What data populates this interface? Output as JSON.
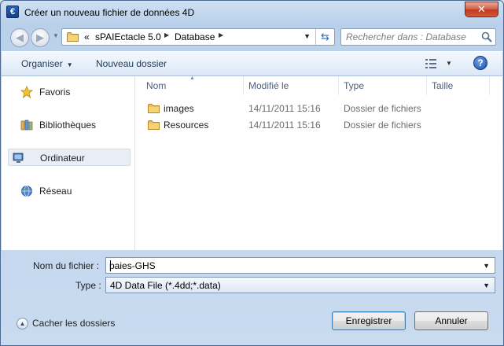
{
  "window": {
    "title": "Créer un nouveau fichier de données 4D",
    "app_icon_glyph": "€",
    "close_glyph": "✕"
  },
  "address": {
    "overflow": "«",
    "segments": [
      "sPAIEctacle 5.0",
      "Database"
    ],
    "search_placeholder": "Rechercher dans : Database"
  },
  "toolbar": {
    "organize_label": "Organiser",
    "new_folder_label": "Nouveau dossier",
    "help_glyph": "?"
  },
  "nav": {
    "items": [
      {
        "label": "Favoris",
        "icon": "star-icon"
      },
      {
        "label": "Bibliothèques",
        "icon": "library-icon"
      },
      {
        "label": "Ordinateur",
        "icon": "computer-icon",
        "selected": true
      },
      {
        "label": "Réseau",
        "icon": "network-icon"
      }
    ]
  },
  "files": {
    "columns": [
      "Nom",
      "Modifié le",
      "Type",
      "Taille"
    ],
    "rows": [
      {
        "name": "images",
        "modified": "14/11/2011 15:16",
        "type": "Dossier de fichiers",
        "size": ""
      },
      {
        "name": "Resources",
        "modified": "14/11/2011 15:16",
        "type": "Dossier de fichiers",
        "size": ""
      }
    ]
  },
  "form": {
    "filename_label": "Nom du fichier :",
    "filename_value": "paies-GHS",
    "type_label": "Type :",
    "type_value": "4D Data File (*.4dd;*.data)"
  },
  "footer": {
    "hide_folders_label": "Cacher les dossiers",
    "save_label": "Enregistrer",
    "cancel_label": "Annuler"
  },
  "colors": {
    "window_frame": "#b9d0ea",
    "close_button": "#c0391d",
    "folder": "#e8c25a"
  }
}
